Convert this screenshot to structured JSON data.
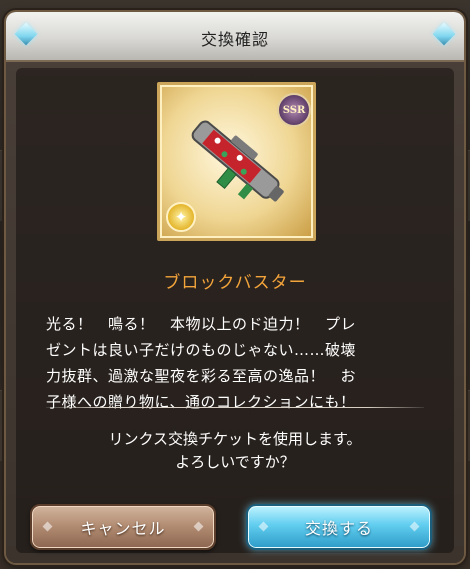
{
  "dialog": {
    "title": "交換確認",
    "item": {
      "rarity": "SSR",
      "name": "ブロックバスター",
      "element_icon": "light-element-icon"
    },
    "description_lines": [
      "光る！　鳴る！　本物以上のド迫力！　プレ",
      "ゼントは良い子だけのものじゃない……破壊",
      "力抜群、過激な聖夜を彩る至高の逸品！　お",
      "子様への贈り物に、通のコレクションにも！"
    ],
    "confirm_lines": [
      "リンクス交換チケットを使用します。",
      "よろしいですか？"
    ],
    "buttons": {
      "cancel": "キャンセル",
      "exchange": "交換する"
    }
  },
  "colors": {
    "item_name": "#f3a43a",
    "cancel_button": "#b08a70",
    "exchange_button": "#61cdef"
  }
}
